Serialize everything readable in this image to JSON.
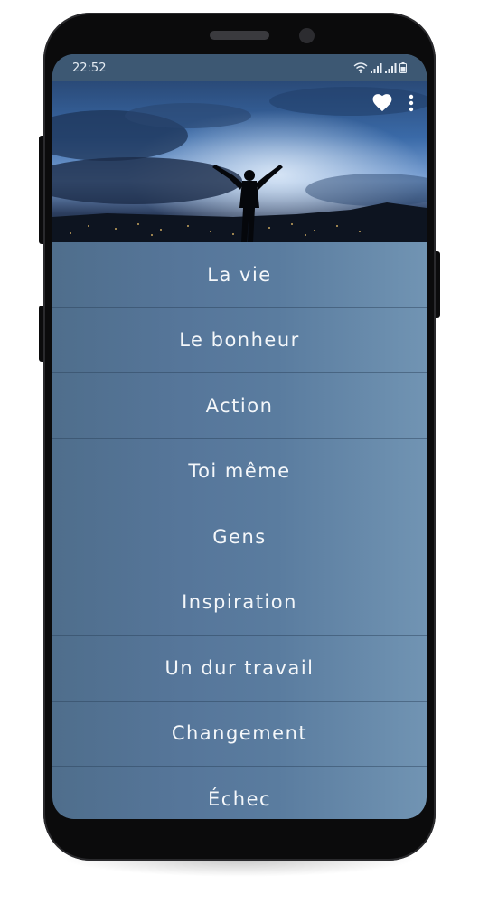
{
  "status_bar": {
    "time": "22:52"
  },
  "header": {
    "favorite_icon": "heart-icon",
    "more_icon": "more-vertical-icon"
  },
  "menu": {
    "items": [
      {
        "label": "La vie"
      },
      {
        "label": "Le bonheur"
      },
      {
        "label": "Action"
      },
      {
        "label": "Toi même"
      },
      {
        "label": "Gens"
      },
      {
        "label": "Inspiration"
      },
      {
        "label": "Un dur travail"
      },
      {
        "label": "Changement"
      },
      {
        "label": "Échec"
      }
    ]
  },
  "colors": {
    "list_background": "#56769a",
    "status_bar": "#3d5873",
    "text": "#f4f7fa",
    "phone_body": "#0b0b0c"
  }
}
